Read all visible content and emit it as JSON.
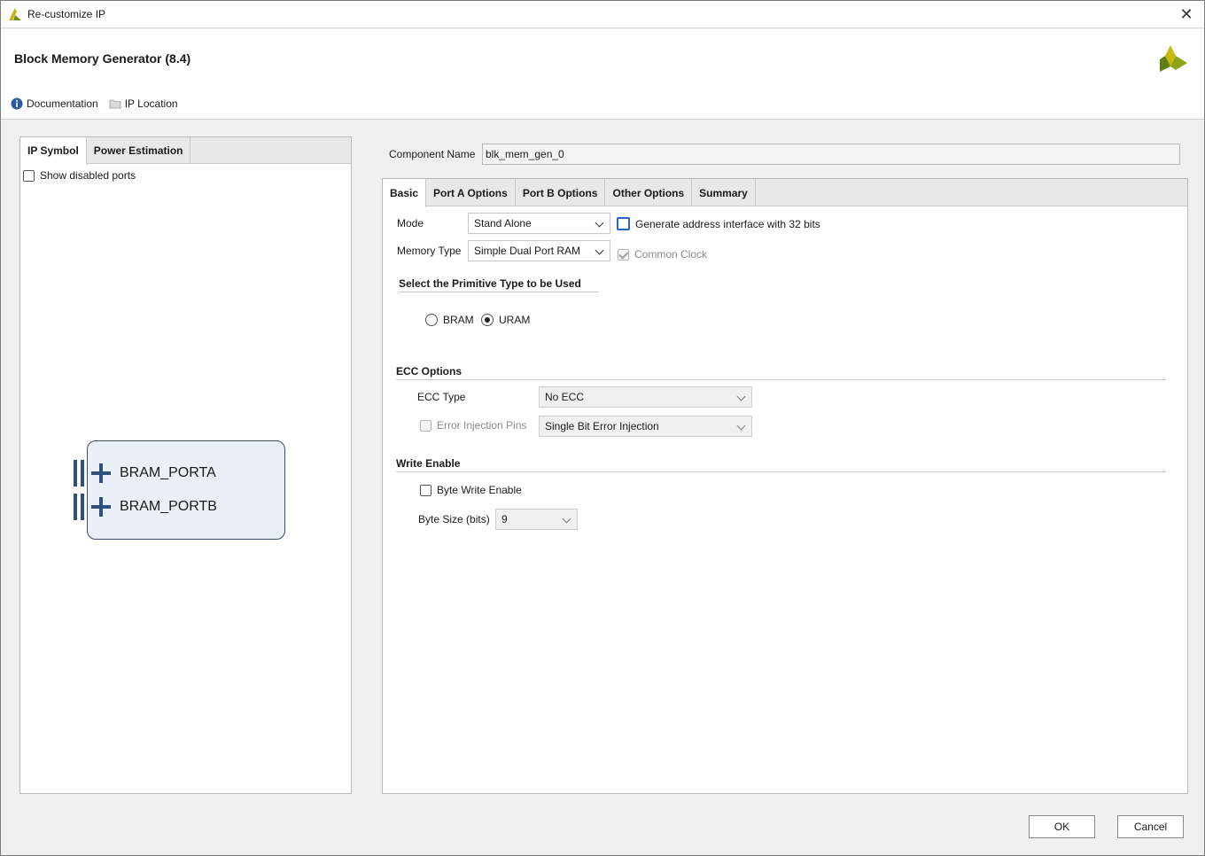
{
  "window": {
    "title": "Re-customize IP",
    "close_glyph": "✕"
  },
  "header": {
    "ip_title": "Block Memory Generator (8.4)",
    "links": {
      "documentation": "Documentation",
      "ip_location": "IP Location"
    }
  },
  "left_panel": {
    "tabs": [
      "IP Symbol",
      "Power Estimation"
    ],
    "show_disabled_ports": "Show disabled ports",
    "ports": [
      "BRAM_PORTA",
      "BRAM_PORTB"
    ]
  },
  "component": {
    "label": "Component Name",
    "value": "blk_mem_gen_0"
  },
  "tabs": [
    "Basic",
    "Port A Options",
    "Port B Options",
    "Other Options",
    "Summary"
  ],
  "basic": {
    "mode_label": "Mode",
    "mode_value": "Stand Alone",
    "memory_type_label": "Memory Type",
    "memory_type_value": "Simple Dual Port RAM",
    "gen_addr_label": "Generate address interface with 32 bits",
    "common_clock_label": "Common Clock",
    "primitive_title": "Select the Primitive Type to be Used",
    "primitive_options": [
      "BRAM",
      "URAM"
    ],
    "ecc_title": "ECC Options",
    "ecc_type_label": "ECC Type",
    "ecc_type_value": "No ECC",
    "error_injection_label": "Error Injection Pins",
    "error_injection_value": "Single Bit Error Injection",
    "write_enable_title": "Write Enable",
    "byte_write_enable_label": "Byte Write Enable",
    "byte_size_label": "Byte Size (bits)",
    "byte_size_value": "9"
  },
  "buttons": {
    "ok": "OK",
    "cancel": "Cancel"
  },
  "colors": {
    "accent": "#2a64c8",
    "symbol_fill": "#e9f0f8",
    "port_color": "#2f4f7f"
  }
}
